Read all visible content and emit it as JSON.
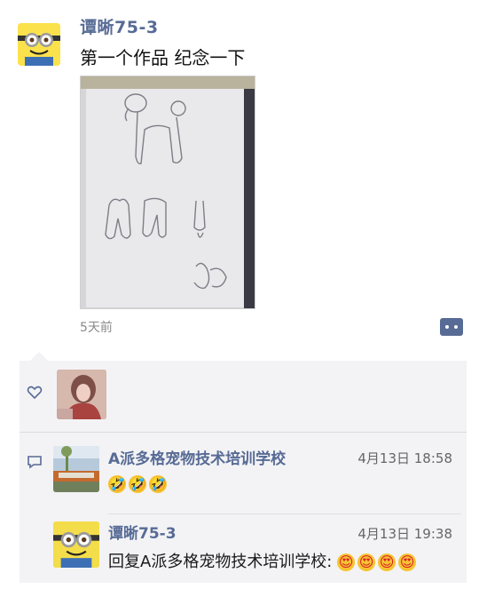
{
  "post": {
    "author": "谭晰75-3",
    "text": "第一个作品 纪念一下",
    "time_ago": "5天前",
    "author_avatar_icon": "minion-avatar",
    "photo_subject": "poodle-sketch-photo"
  },
  "likes": {
    "icon": "heart-icon",
    "avatars": [
      "liker-avatar-photo"
    ]
  },
  "comments": [
    {
      "name": "A派多格宠物技术培训学校",
      "time": "4月13日 18:58",
      "text": "",
      "emojis": [
        "🤣",
        "🤣",
        "🤣"
      ],
      "avatar_icon": "school-building-avatar"
    },
    {
      "name": "谭晰75-3",
      "time": "4月13日 19:38",
      "text": "回复A派多格宠物技术培训学校:",
      "emojis": [
        "😍",
        "😍",
        "😍",
        "😍"
      ],
      "avatar_icon": "minion-avatar"
    }
  ],
  "colors": {
    "link_blue": "#576b95",
    "panel_bg": "#f3f3f5"
  }
}
